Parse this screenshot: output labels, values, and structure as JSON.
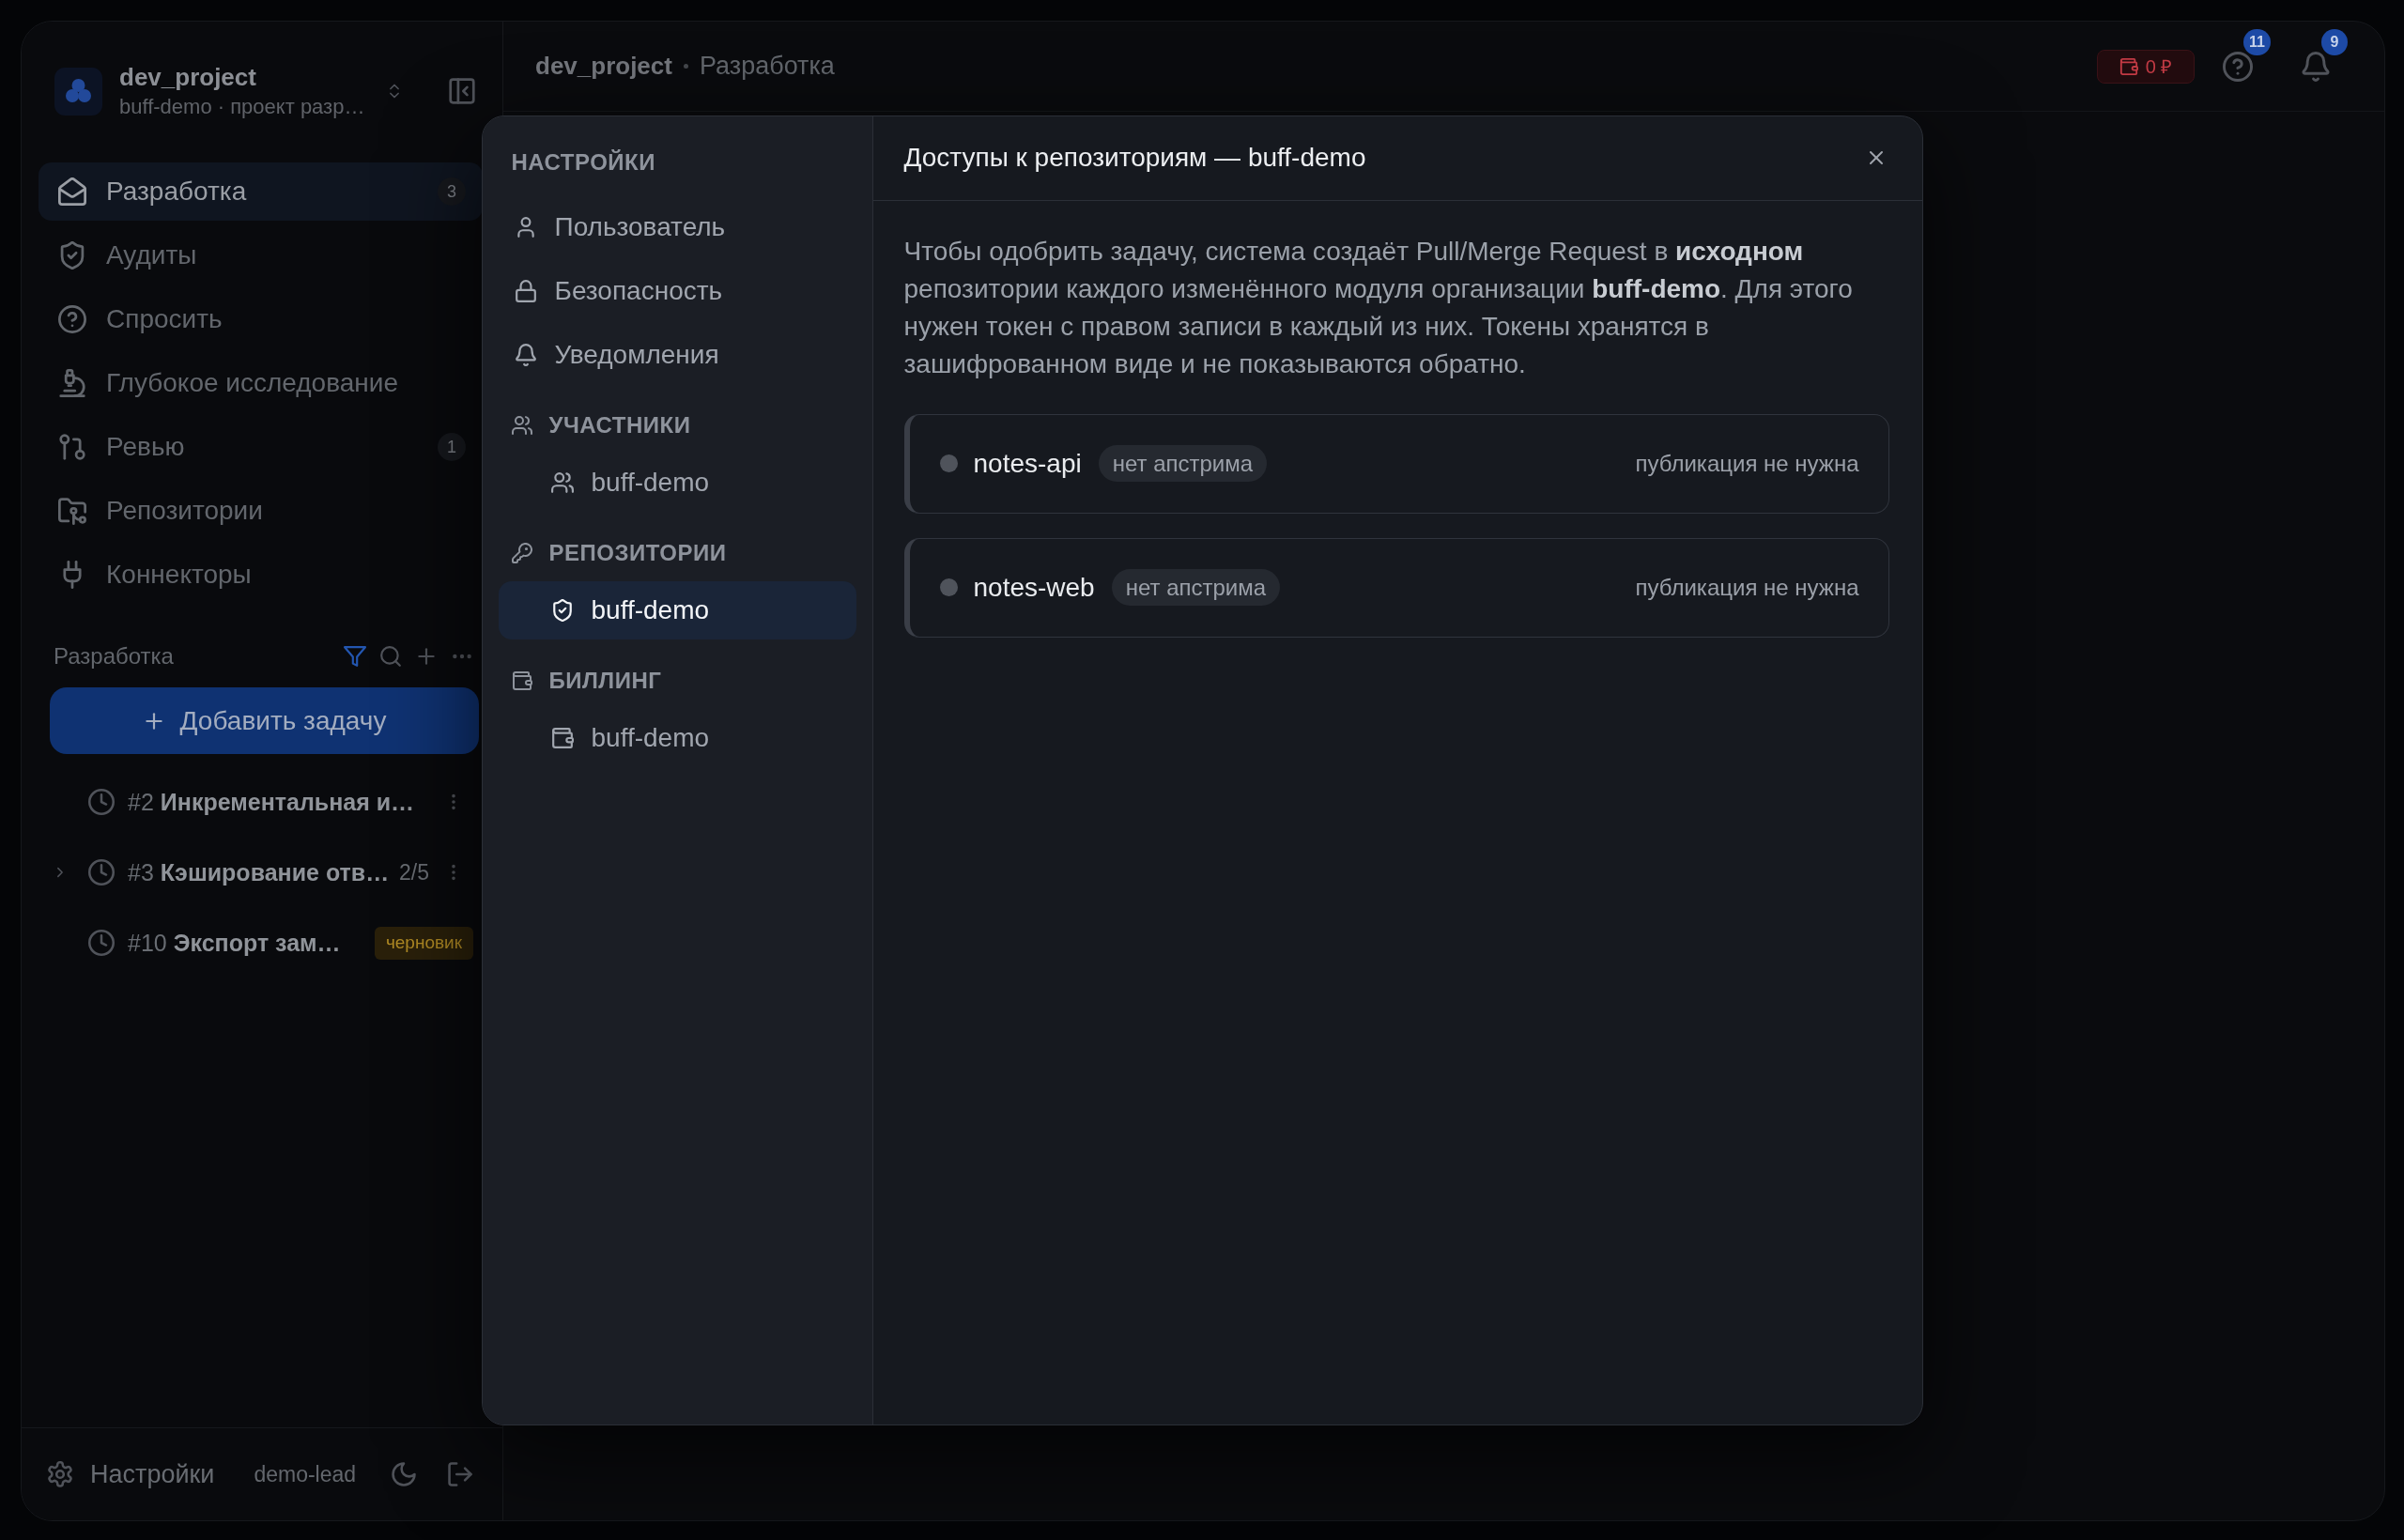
{
  "app": {
    "project": {
      "name": "dev_project",
      "subtitle": "buff-demo · проект разр…"
    },
    "nav": [
      {
        "label": "Разработка",
        "selected": true,
        "count": "3"
      },
      {
        "label": "Аудиты",
        "selected": false
      },
      {
        "label": "Спросить",
        "selected": false
      },
      {
        "label": "Глубокое исследование",
        "selected": false
      },
      {
        "label": "Ревью",
        "selected": false,
        "count": "1"
      },
      {
        "label": "Репозитории",
        "selected": false
      },
      {
        "label": "Коннекторы",
        "selected": false
      }
    ],
    "tasks_panel": {
      "title": "Разработка",
      "filter_active": true,
      "add_button": "Добавить задачу",
      "tasks": [
        {
          "number": "#2",
          "title": "Инкрементальная и…",
          "collapsible": false
        },
        {
          "number": "#3",
          "title": "Кэширование отв…",
          "collapsible": true,
          "progress": "2/5"
        },
        {
          "number": "#10",
          "title": "Экспорт зам…",
          "collapsible": false,
          "badge": "черновик"
        }
      ]
    },
    "footer": {
      "settings": "Настройки",
      "user": "demo-lead"
    }
  },
  "topbar": {
    "breadcrumb": [
      "dev_project",
      "Разработка"
    ],
    "balance": "0 ₽",
    "help_count": "11",
    "notification_count": "9"
  },
  "settings": {
    "heading": "НАСТРОЙКИ",
    "items": [
      {
        "label": "Пользователь",
        "selected": false
      },
      {
        "label": "Безопасность",
        "selected": false
      },
      {
        "label": "Уведомления",
        "selected": false
      }
    ],
    "groups": [
      {
        "title": "УЧАСТНИКИ",
        "items": [
          {
            "label": "buff-demo",
            "selected": false
          }
        ]
      },
      {
        "title": "РЕПОЗИТОРИИ",
        "items": [
          {
            "label": "buff-demo",
            "selected": true
          }
        ]
      },
      {
        "title": "БИЛЛИНГ",
        "items": [
          {
            "label": "buff-demo",
            "selected": false
          }
        ]
      }
    ],
    "panel": {
      "title": "Доступы к репозиториям — buff-demo",
      "description": "Чтобы одобрить задачу, система создаёт Pull/Merge Request в **исходном** репозитории каждого изменённого модуля организации **buff-demo**. Для этого нужен токен с правом записи в каждый из них. Токены хранятся в зашифрованном виде и не показываются обратно.",
      "repos": [
        {
          "name": "notes-api",
          "tag": "нет апстрима",
          "status": "публикация не нужна"
        },
        {
          "name": "notes-web",
          "tag": "нет апстрима",
          "status": "публикация не нужна"
        }
      ]
    }
  }
}
